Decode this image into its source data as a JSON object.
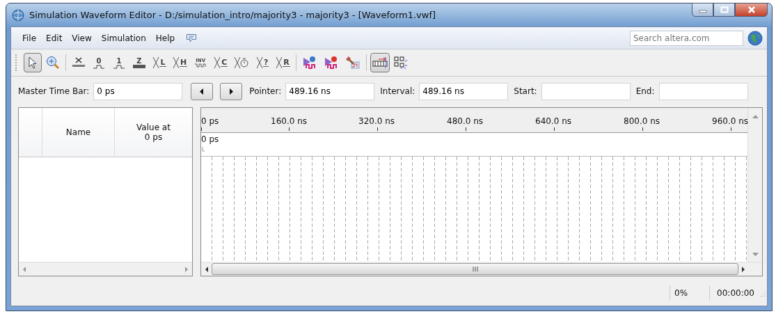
{
  "window": {
    "title": "Simulation Waveform Editor - D:/simulation_intro/majority3 - majority3 - [Waveform1.vwf]"
  },
  "menu": [
    "File",
    "Edit",
    "View",
    "Simulation",
    "Help"
  ],
  "search": {
    "placeholder": "Search altera.com"
  },
  "toolbar": [
    {
      "kind": "select",
      "pressed": true
    },
    {
      "kind": "zoom",
      "pressed": false
    },
    {
      "kind": "sep"
    },
    {
      "kind": "unknown",
      "pressed": false
    },
    {
      "kind": "level",
      "glyph": "0",
      "pressed": false
    },
    {
      "kind": "level",
      "glyph": "1",
      "pressed": false
    },
    {
      "kind": "highz",
      "glyph": "Z",
      "pressed": false
    },
    {
      "kind": "cross",
      "glyph": "L",
      "pressed": false
    },
    {
      "kind": "cross",
      "glyph": "H",
      "pressed": false
    },
    {
      "kind": "invert",
      "glyph": "INV",
      "pressed": false
    },
    {
      "kind": "cross",
      "glyph": "C",
      "pressed": false
    },
    {
      "kind": "clock",
      "pressed": false
    },
    {
      "kind": "cross",
      "glyph": "?",
      "pressed": false
    },
    {
      "kind": "cross",
      "glyph": "R",
      "pressed": false
    },
    {
      "kind": "sep"
    },
    {
      "kind": "run",
      "pressed": false
    },
    {
      "kind": "run-timing",
      "pressed": false
    },
    {
      "kind": "hammer",
      "pressed": false
    },
    {
      "kind": "sep"
    },
    {
      "kind": "snap",
      "pressed": true
    },
    {
      "kind": "grid",
      "pressed": false
    }
  ],
  "timebar": {
    "master_label": "Master Time Bar:",
    "master_value": "0 ps",
    "pointer_label": "Pointer:",
    "pointer_value": "489.16 ns",
    "interval_label": "Interval:",
    "interval_value": "489.16 ns",
    "start_label": "Start:",
    "end_label": "End:"
  },
  "signals": {
    "columns": [
      "Name",
      "Value at\n0 ps"
    ]
  },
  "ruler": {
    "ticks": [
      "0 ps",
      "160.0 ns",
      "320.0 ns",
      "480.0 ns",
      "640.0 ns",
      "800.0 ns",
      "960.0 ns"
    ],
    "cursor": "0 ps"
  },
  "status_bar": {
    "progress": "0%",
    "elapsed": "00:00:00"
  }
}
